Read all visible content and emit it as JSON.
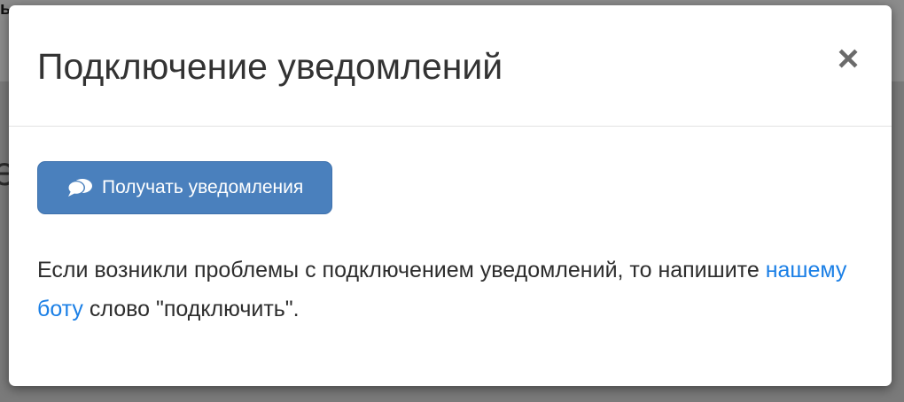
{
  "background": {
    "corner_text": "ь",
    "side_glyph": "е"
  },
  "modal": {
    "title": "Подключение уведомлений",
    "close_label": "×",
    "primary_button": {
      "label": "Получать уведомления",
      "icon": "comments-icon",
      "color": "#4a80bd"
    },
    "help_text": {
      "before_link": "Если возникли проблемы с подключением уведомлений, то напишите ",
      "link_text": "нашему боту",
      "after_link": " слово \"подключить\"."
    },
    "link_color": "#1a7fe6"
  }
}
